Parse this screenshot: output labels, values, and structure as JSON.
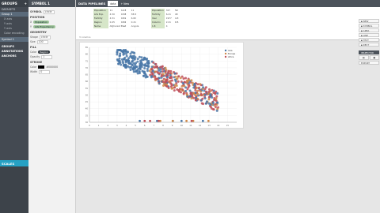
{
  "groups": {
    "title": "GROUPS",
    "btn": "+",
    "items": [
      "DATASETS",
      "Group 1",
      "X axis",
      "Y axis",
      "Y axis",
      "Color encoding",
      "Symbol 1"
    ],
    "sections": [
      "GROUPS",
      "ANNOTATIONS",
      "ANCHORS"
    ]
  },
  "scales": {
    "title": "SCALES"
  },
  "symbol": {
    "title": "SYMBOL 1",
    "sections": {
      "symbol": "SYMBOL",
      "position": "POSITION",
      "geometry": "GEOMETRY",
      "fill": "FILL",
      "stroke": "STROKE"
    },
    "symbol_value": "circle",
    "x_label": "X",
    "x_field": "Population",
    "y_label": "Y",
    "y_field": "Life Expectancy",
    "shape_label": "Shape",
    "shape_value": "circle",
    "size_label": "Size",
    "size_value": "100",
    "color_label": "Color",
    "color_field": "Region",
    "opacity_label": "Opacity",
    "opacity_value": "1",
    "stroke_color_label": "Color",
    "stroke_color_value": "#000000",
    "width_label": "Width",
    "width_value": "0"
  },
  "main": {
    "tabs": [
      "DATA PIPELINES",
      "data",
      "+ New"
    ]
  },
  "pipeline": {
    "blocks": [
      {
        "rows": [
          [
            "Population",
            "11"
          ],
          [
            "Life Exp.",
            "4.50"
          ],
          [
            "Fertility",
            "4.51"
          ],
          [
            "Region",
            "0.45"
          ],
          [
            "Name",
            "Afghanistan"
          ]
        ]
      },
      {
        "rows": [
          [
            "12.8",
            "11"
          ],
          [
            "0.58",
            "38.8"
          ],
          [
            "0.81",
            "6.82"
          ],
          [
            "0.82",
            "0.21"
          ],
          [
            "East",
            "Angola"
          ]
        ]
      },
      {
        "rows": [
          [
            "Population",
            "327"
          ],
          [
            "Fertility",
            "6.21"
          ],
          [
            "Year",
            "1977"
          ],
          [
            "Column",
            "2.21"
          ],
          [
            "1.8",
            "4"
          ]
        ]
      },
      {
        "rows": [
          [
            "59",
            ""
          ],
          [
            "43",
            ""
          ],
          [
            "4.3",
            ""
          ],
          [
            "0.5",
            ""
          ],
          [
            "",
            ""
          ]
        ]
      }
    ],
    "footer": "3 columns"
  },
  "tools": {
    "buttons": [
      "NEW",
      "SYMBOL",
      "AREA",
      "LINE",
      "TEXT",
      "RECT"
    ],
    "export": "EXPORT",
    "dark": "INSPECTOR"
  },
  "chart_data": {
    "type": "scatter",
    "xlim": [
      0,
      16
    ],
    "ylim": [
      30,
      85
    ],
    "x_ticks": [
      "0",
      "1",
      "2",
      "3",
      "4",
      "5",
      "6",
      "7",
      "8",
      "9",
      "10",
      "11",
      "12",
      "13",
      "14",
      "15"
    ],
    "y_ticks": [
      "30",
      "35",
      "40",
      "45",
      "50",
      "55",
      "60",
      "65",
      "70",
      "75",
      "80",
      "85"
    ],
    "series": [
      {
        "name": "Asia",
        "color": "#4a78a8"
      },
      {
        "name": "Europe",
        "color": "#d0894a"
      },
      {
        "name": "Africa",
        "color": "#c0505a"
      }
    ]
  }
}
